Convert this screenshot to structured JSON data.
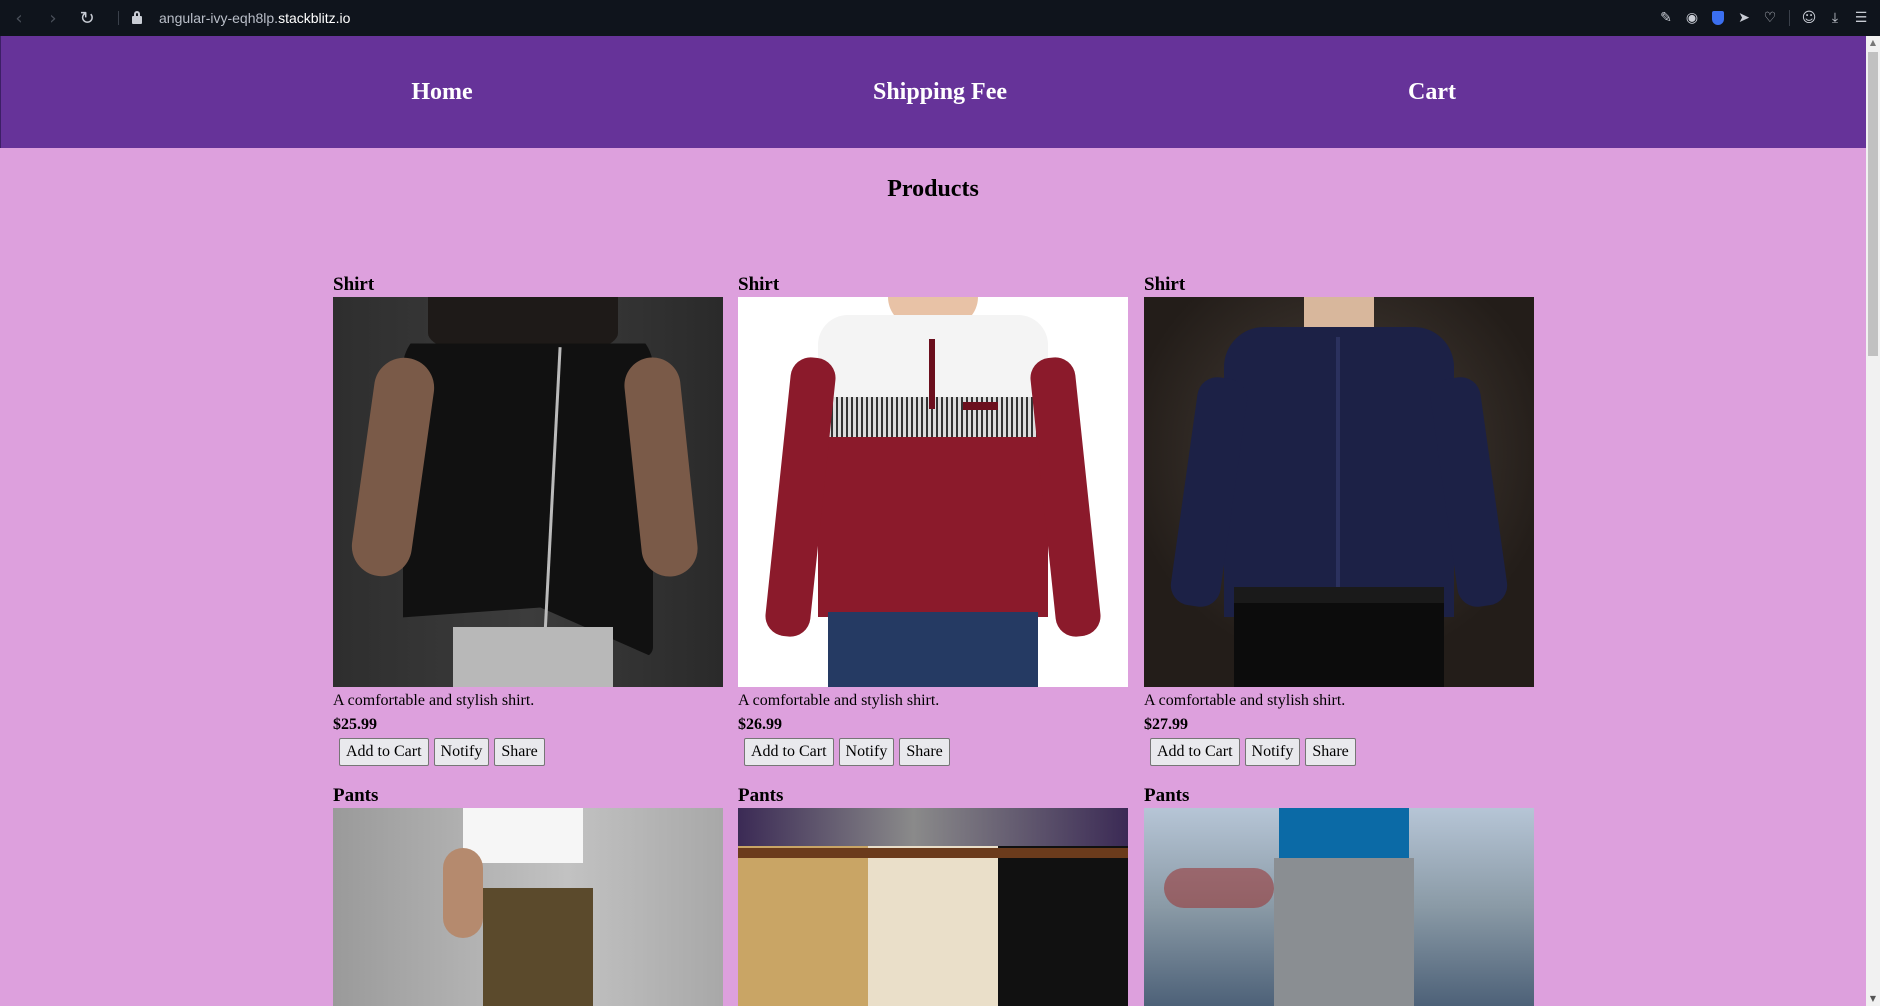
{
  "browser": {
    "url_prefix": "angular-ivy-eqh8lp.",
    "url_domain": "stackblitz.io"
  },
  "nav": {
    "home": "Home",
    "shipping": "Shipping Fee",
    "cart": "Cart"
  },
  "page": {
    "title": "Products"
  },
  "products": [
    {
      "name": "Shirt",
      "description": "A comfortable and stylish shirt.",
      "price": "$25.99"
    },
    {
      "name": "Shirt",
      "description": "A comfortable and stylish shirt.",
      "price": "$26.99"
    },
    {
      "name": "Shirt",
      "description": "A comfortable and stylish shirt.",
      "price": "$27.99"
    },
    {
      "name": "Pants"
    },
    {
      "name": "Pants"
    },
    {
      "name": "Pants"
    }
  ],
  "buttons": {
    "add_to_cart": "Add to Cart",
    "notify": "Notify",
    "share": "Share"
  },
  "colors": {
    "header_bg": "#663399",
    "page_bg": "#dda0dd",
    "chrome_bg": "#0f141c"
  }
}
